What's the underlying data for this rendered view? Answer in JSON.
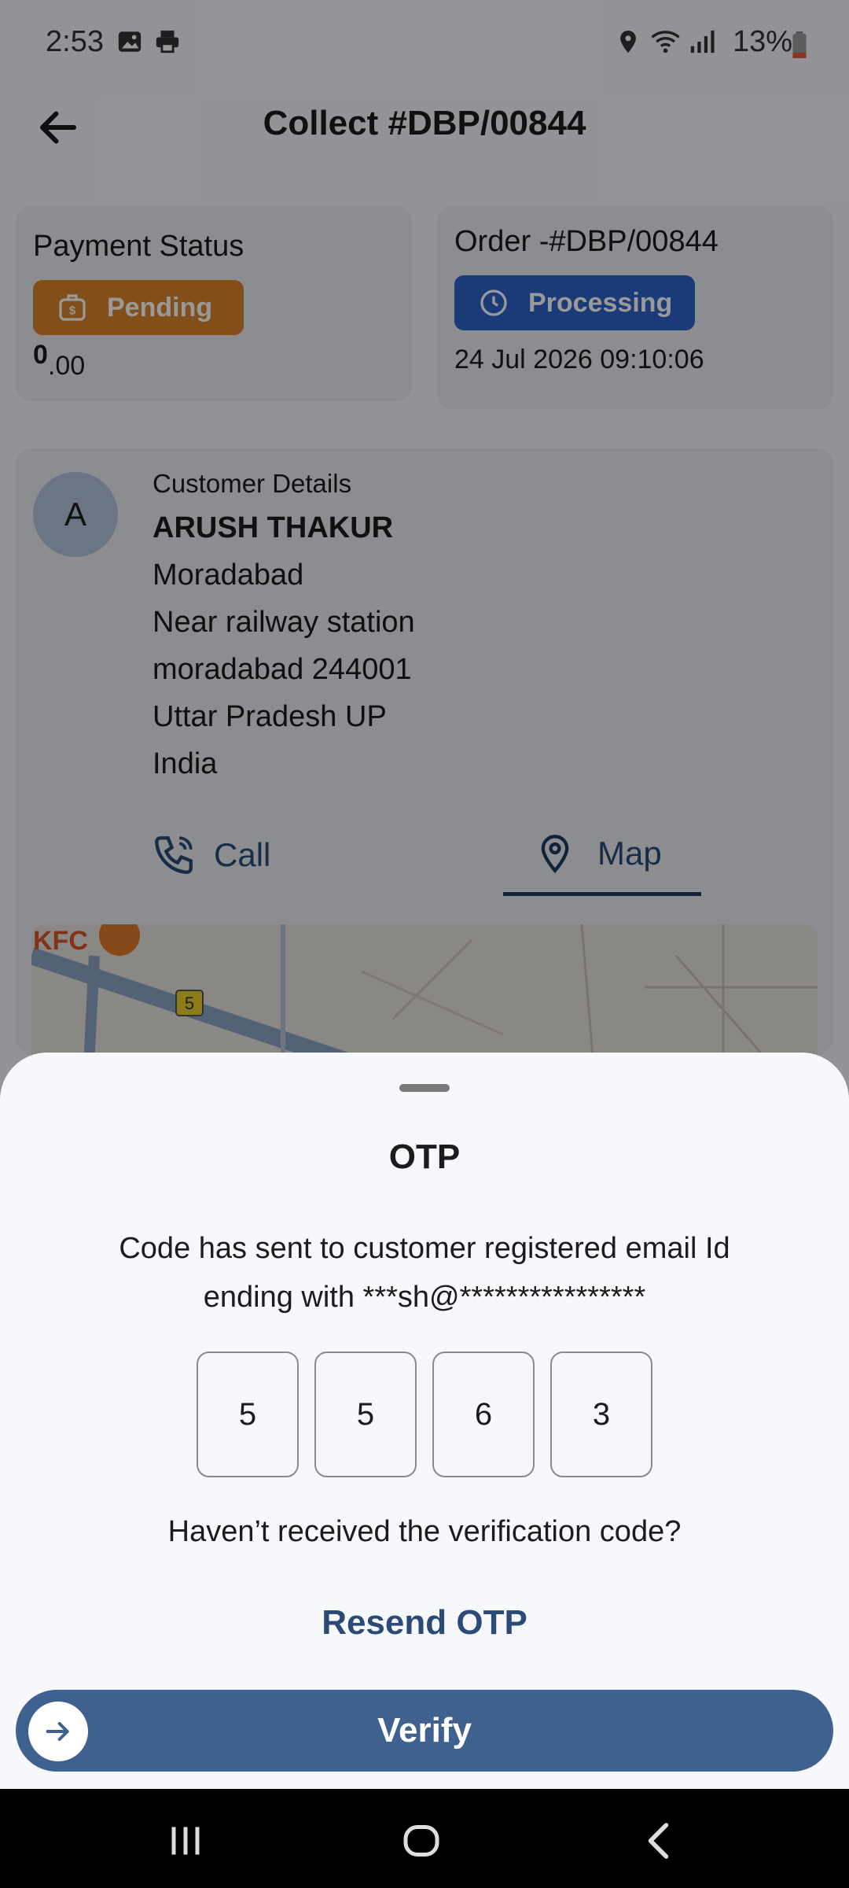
{
  "status_bar": {
    "time": "2:53",
    "battery": "13%"
  },
  "app_bar": {
    "title": "Collect #DBP/00844"
  },
  "payment_card": {
    "label": "Payment Status",
    "status": "Pending",
    "amount_major": "0",
    "amount_minor": ".00",
    "color": "#d9822b"
  },
  "order_card": {
    "label": "Order -#DBP/00844",
    "status": "Processing",
    "datetime": "24 Jul 2026 09:10:06",
    "color": "#2e63c8"
  },
  "customer": {
    "avatar_letter": "A",
    "heading": "Customer Details",
    "name": "ARUSH THAKUR",
    "lines": [
      "Moradabad",
      "Near railway station",
      "moradabad 244001",
      "Uttar Pradesh UP",
      "India"
    ],
    "call_label": "Call",
    "map_label": "Map"
  },
  "map": {
    "label_kfc": "KFC",
    "road_number": "5"
  },
  "otp_sheet": {
    "title": "OTP",
    "message_line1": "Code has sent to customer registered email Id",
    "message_line2": "ending with ***sh@****************",
    "digits": [
      "5",
      "5",
      "6",
      "3"
    ],
    "not_received": "Haven’t received the verification code?",
    "resend_label": "Resend OTP",
    "verify_label": "Verify"
  }
}
